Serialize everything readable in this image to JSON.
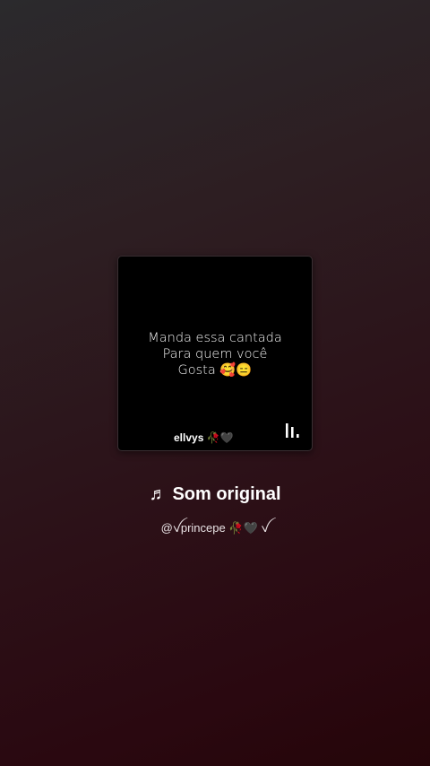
{
  "post": {
    "caption_lines": [
      "Manda essa cantada",
      "Para quem você",
      "Gosta 🥰😑"
    ],
    "author": "ellvys 🥀🖤"
  },
  "audio": {
    "note_glyph": "♬",
    "title": "Som original",
    "username": "@ꪜprincepe 🥀🖤 ꪜ"
  },
  "icons": {
    "note": "music-note-icon",
    "bars": "audio-bars-icon"
  }
}
